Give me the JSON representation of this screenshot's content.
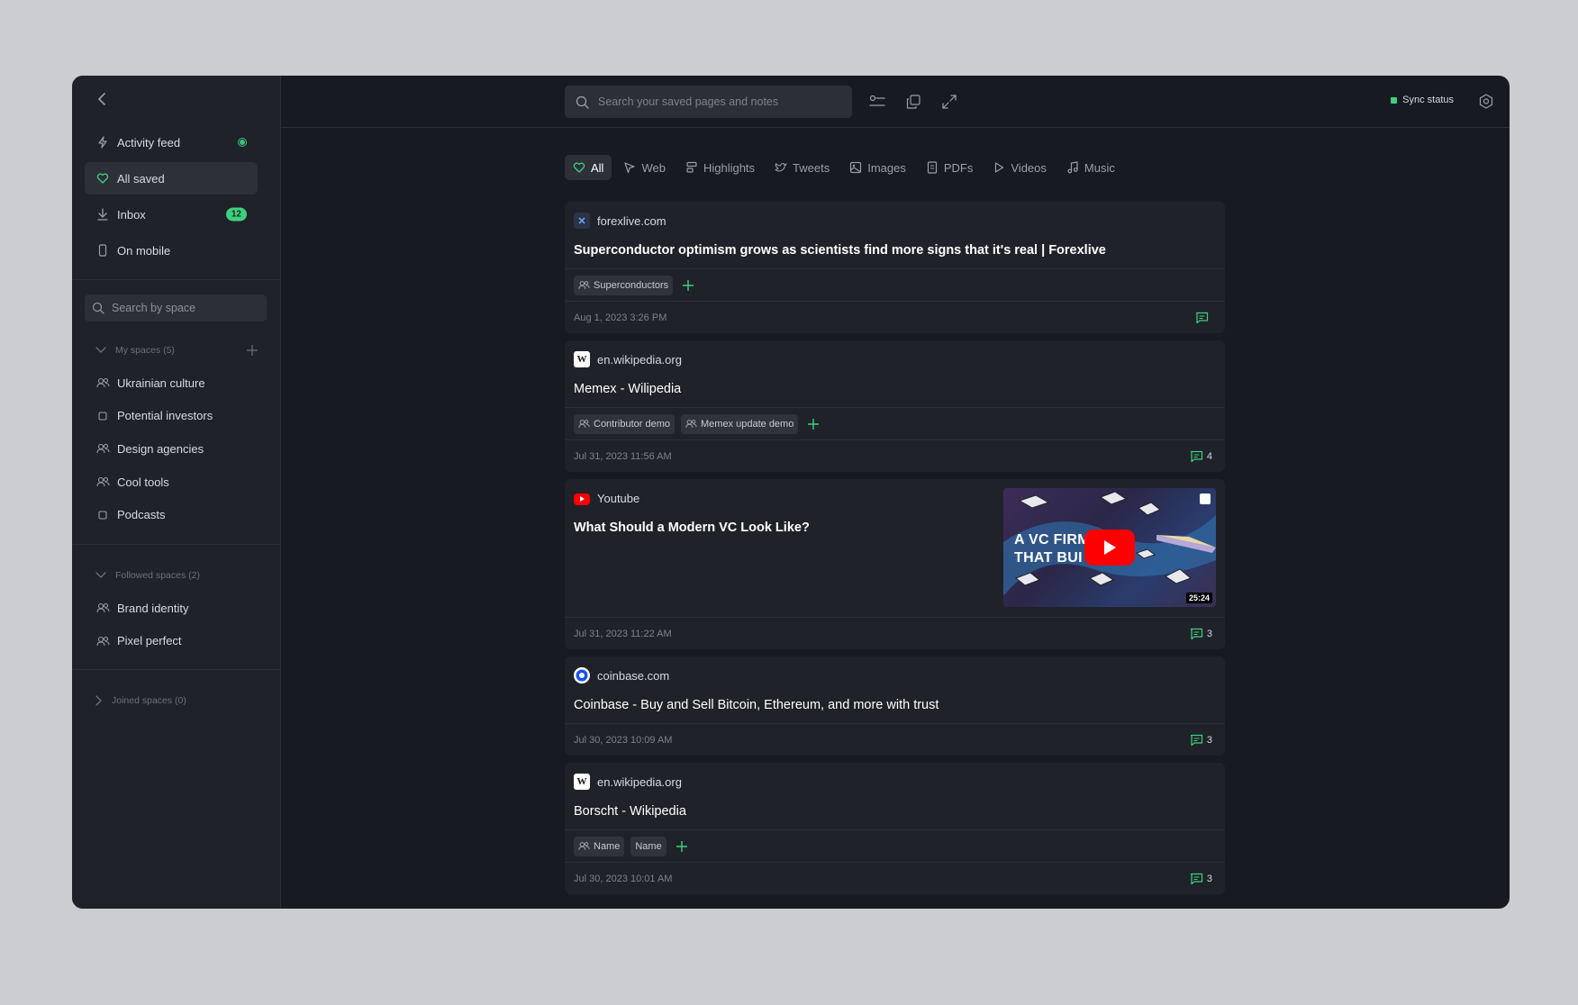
{
  "sidebar": {
    "nav": [
      {
        "label": "Activity feed",
        "icon": "bolt-icon"
      },
      {
        "label": "All saved",
        "icon": "heart-icon"
      },
      {
        "label": "Inbox",
        "icon": "download-icon",
        "badge": "12"
      },
      {
        "label": "On mobile",
        "icon": "mobile-icon"
      }
    ],
    "space_search_placeholder": "Search by space",
    "my_spaces_title": "My spaces (5)",
    "my_spaces": [
      {
        "label": "Ukrainian culture",
        "icon": "people-icon"
      },
      {
        "label": "Potential investors",
        "icon": "square-icon"
      },
      {
        "label": "Design agencies",
        "icon": "people-icon"
      },
      {
        "label": "Cool tools",
        "icon": "people-icon"
      },
      {
        "label": "Podcasts",
        "icon": "square-icon"
      }
    ],
    "followed_spaces_title": "Followed spaces (2)",
    "followed_spaces": [
      {
        "label": "Brand identity",
        "icon": "people-icon"
      },
      {
        "label": "Pixel perfect",
        "icon": "people-icon"
      }
    ],
    "joined_spaces_title": "Joined spaces (0)"
  },
  "topbar": {
    "search_placeholder": "Search your saved pages and notes",
    "sync_label": "Sync status"
  },
  "tabs": [
    {
      "label": "All",
      "icon": "heart-icon"
    },
    {
      "label": "Web",
      "icon": "cursor-icon"
    },
    {
      "label": "Highlights",
      "icon": "highlight-icon"
    },
    {
      "label": "Tweets",
      "icon": "bird-icon"
    },
    {
      "label": "Images",
      "icon": "image-icon"
    },
    {
      "label": "PDFs",
      "icon": "document-icon"
    },
    {
      "label": "Videos",
      "icon": "play-icon"
    },
    {
      "label": "Music",
      "icon": "music-icon"
    }
  ],
  "cards": [
    {
      "source": "forexlive.com",
      "title": "Superconductor optimism grows as scientists find more signs that it's real | Forexlive",
      "tags": [
        "Superconductors"
      ],
      "date": "Aug 1, 2023 3:26 PM",
      "comments": ""
    },
    {
      "source": "en.wikipedia.org",
      "title": "Memex - Wilipedia",
      "tags": [
        "Contributor demo",
        "Memex update demo"
      ],
      "date": "Jul 31, 2023 11:56 AM",
      "comments": "4"
    },
    {
      "source": "Youtube",
      "title": "What Should a Modern VC Look Like?",
      "thumbnail_text": [
        "A VC FIRM",
        "THAT BUI"
      ],
      "thumbnail_duration": "25:24",
      "date": "Jul 31, 2023 11:22 AM",
      "comments": "3"
    },
    {
      "source": "coinbase.com",
      "title": "Coinbase - Buy and Sell Bitcoin, Ethereum, and more with trust",
      "date": "Jul 30, 2023 10:09 AM",
      "comments": "3"
    },
    {
      "source": "en.wikipedia.org",
      "title": "Borscht - Wikipedia",
      "tags": [
        "Name",
        "Name"
      ],
      "date": "Jul 30, 2023 10:01 AM",
      "comments": "3"
    }
  ],
  "colors": {
    "accent": "#3ed07f",
    "background": "#181a21",
    "sidebar": "#202229",
    "card": "#202229"
  }
}
